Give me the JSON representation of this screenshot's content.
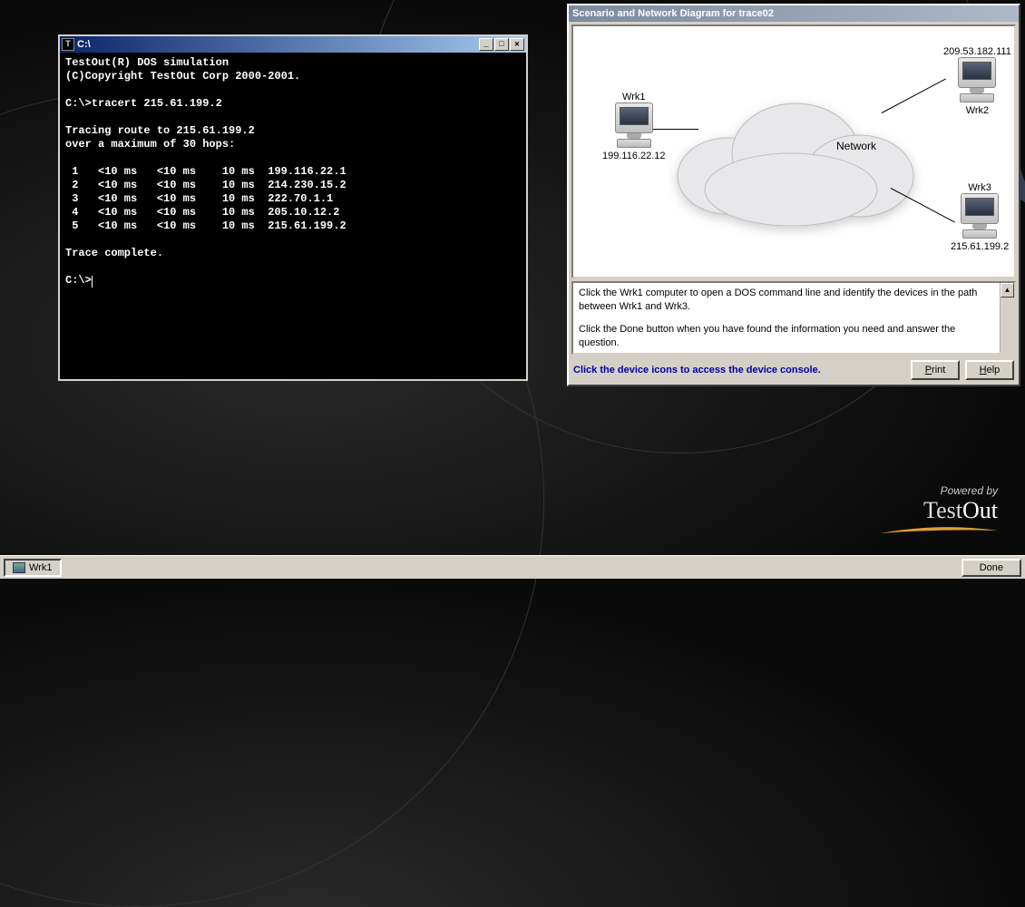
{
  "dos": {
    "title": "C:\\",
    "icon_letter": "T",
    "min_glyph": "_",
    "max_glyph": "□",
    "close_glyph": "✕",
    "lines": [
      "TestOut(R) DOS simulation",
      "(C)Copyright TestOut Corp 2000-2001.",
      "",
      "C:\\>tracert 215.61.199.2",
      "",
      "Tracing route to 215.61.199.2",
      "over a maximum of 30 hops:",
      "",
      " 1   <10 ms   <10 ms    10 ms  199.116.22.1",
      " 2   <10 ms   <10 ms    10 ms  214.230.15.2",
      " 3   <10 ms   <10 ms    10 ms  222.70.1.1",
      " 4   <10 ms   <10 ms    10 ms  205.10.12.2",
      " 5   <10 ms   <10 ms    10 ms  215.61.199.2",
      "",
      "Trace complete.",
      "",
      "C:\\>"
    ]
  },
  "scenario": {
    "title": "Scenario and Network Diagram for trace02",
    "network_label": "Network",
    "nodes": {
      "wrk1": {
        "label": "Wrk1",
        "ip": "199.116.22.12"
      },
      "wrk2": {
        "label": "Wrk2",
        "ip": "209.53.182.111"
      },
      "wrk3": {
        "label": "Wrk3",
        "ip": "215.61.199.2"
      }
    },
    "instructions_p1": "Click the Wrk1 computer to open a DOS command line and identify the devices in the path between Wrk1 and Wrk3.",
    "instructions_p2": "Click the Done button when you have found the information you need and answer the question.",
    "hint": "Click the device icons to access the device console.",
    "print_label": "Print",
    "help_label": "Help"
  },
  "brand": {
    "top": "Powered by",
    "left": "Test",
    "right": "Out"
  },
  "taskbar": {
    "task_label": "Wrk1",
    "done_label": "Done"
  }
}
